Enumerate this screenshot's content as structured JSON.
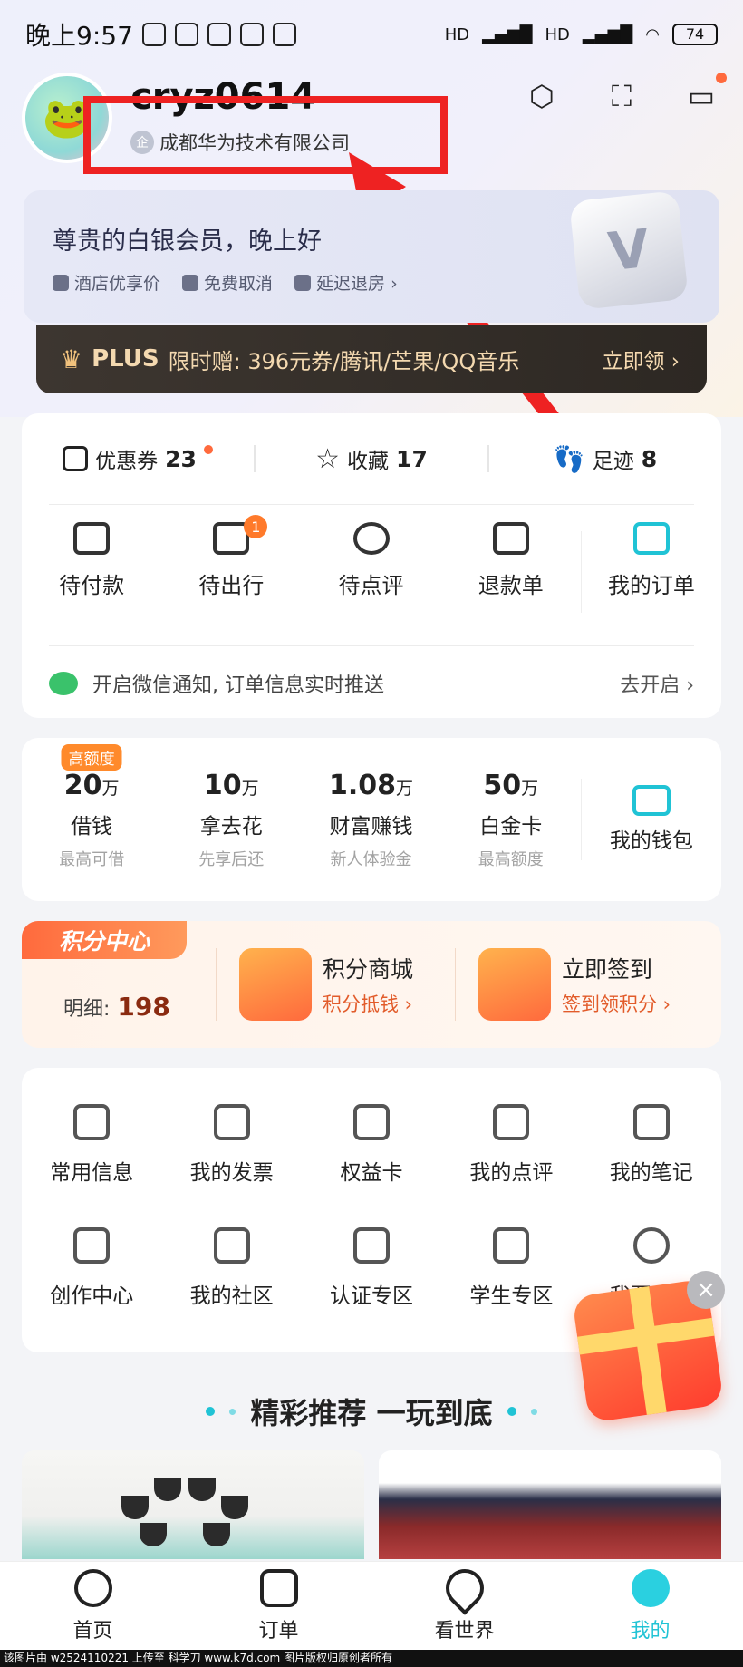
{
  "status_bar": {
    "time": "晚上9:57",
    "battery": "74",
    "signal_label_1": "HD",
    "signal_label_2": "HD"
  },
  "profile": {
    "username": "cryz0614",
    "company": "成都华为技术有限公司",
    "company_badge": "企"
  },
  "header_icons": [
    "settings-hexagon-icon",
    "scan-icon",
    "message-icon"
  ],
  "member": {
    "title": "尊贵的白银会员，晚上好",
    "perks": [
      "酒店优享价",
      "免费取消",
      "延迟退房 ›"
    ],
    "badge_letter": "V"
  },
  "plus_banner": {
    "brand": "PLUS",
    "text": "限时赠: 396元券/腾讯/芒果/QQ音乐",
    "cta": "立即领 ›"
  },
  "stats": [
    {
      "label": "优惠券",
      "value": "23",
      "icon": "coupon-icon",
      "dot": true
    },
    {
      "label": "收藏",
      "value": "17",
      "icon": "star-icon",
      "dot": false
    },
    {
      "label": "足迹",
      "value": "8",
      "icon": "footprint-icon",
      "dot": false
    }
  ],
  "orders": [
    {
      "label": "待付款",
      "icon": "wallet-card-icon",
      "badge": ""
    },
    {
      "label": "待出行",
      "icon": "luggage-icon",
      "badge": "1"
    },
    {
      "label": "待点评",
      "icon": "comment-heart-icon",
      "badge": ""
    },
    {
      "label": "退款单",
      "icon": "refund-icon",
      "badge": ""
    },
    {
      "label": "我的订单",
      "icon": "order-doc-icon",
      "badge": ""
    }
  ],
  "wechat_notice": {
    "text": "开启微信通知, 订单信息实时推送",
    "action": "去开启 ›"
  },
  "finance": [
    {
      "amount": "20",
      "unit": "万",
      "name": "借钱",
      "sub": "最高可借",
      "tag": "高额度"
    },
    {
      "amount": "10",
      "unit": "万",
      "name": "拿去花",
      "sub": "先享后还",
      "tag": ""
    },
    {
      "amount": "1.08",
      "unit": "万",
      "name": "财富赚钱",
      "sub": "新人体验金",
      "tag": ""
    },
    {
      "amount": "50",
      "unit": "万",
      "name": "白金卡",
      "sub": "最高额度",
      "tag": ""
    }
  ],
  "wallet": {
    "label": "我的钱包"
  },
  "points": {
    "title": "积分中心",
    "detail_label": "明细:",
    "detail_value": "198",
    "items": [
      {
        "title": "积分商城",
        "sub": "积分抵钱 ›"
      },
      {
        "title": "立即签到",
        "sub": "签到领积分 ›"
      }
    ]
  },
  "services": [
    {
      "label": "常用信息",
      "icon": "id-card-icon"
    },
    {
      "label": "我的发票",
      "icon": "invoice-icon"
    },
    {
      "label": "权益卡",
      "icon": "crown-card-icon"
    },
    {
      "label": "我的点评",
      "icon": "review-icon"
    },
    {
      "label": "我的笔记",
      "icon": "note-pen-icon"
    },
    {
      "label": "创作中心",
      "icon": "camera-icon"
    },
    {
      "label": "我的社区",
      "icon": "community-icon"
    },
    {
      "label": "认证专区",
      "icon": "verified-icon"
    },
    {
      "label": "学生专区",
      "icon": "graduation-cap-icon"
    },
    {
      "label": "我要吐槽",
      "icon": "sad-face-icon"
    }
  ],
  "recommend": {
    "title": "精彩推荐 一玩到底"
  },
  "tabbar": [
    {
      "label": "首页",
      "icon": "home-frog-icon",
      "active": false
    },
    {
      "label": "订单",
      "icon": "order-icon",
      "active": false
    },
    {
      "label": "看世界",
      "icon": "location-pin-icon",
      "active": false
    },
    {
      "label": "我的",
      "icon": "profile-smile-icon",
      "active": true
    }
  ],
  "footer_watermark": "该图片由 w2524110221 上传至 科学刀 www.k7d.com 图片版权归原创者所有",
  "colors": {
    "accent": "#20c3d5",
    "annotation": "#ee2222",
    "orange": "#ff6a3d"
  }
}
